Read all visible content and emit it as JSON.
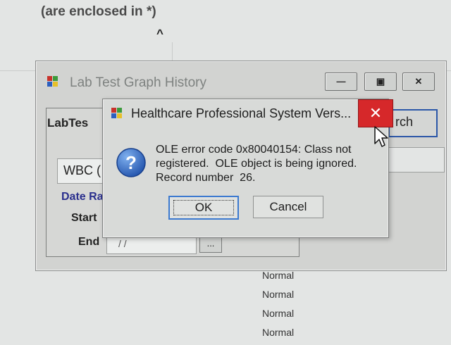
{
  "background": {
    "header_text": "(are enclosed in *)",
    "caret": "^",
    "rows": [
      "Normal",
      "Normal",
      "Normal",
      "Normal"
    ]
  },
  "back_window": {
    "title": "Lab Test Graph History",
    "minimize_glyph": "—",
    "maximize_glyph": "▣",
    "close_glyph": "✕",
    "labtest_label": "LabTes",
    "search_label": "rch",
    "wbc_value": "WBC (",
    "date_range_label": "Date Ra",
    "start_label": "Start",
    "end_label": "End",
    "end_value": "/ /",
    "browse_label": "..."
  },
  "dialog": {
    "title": "Healthcare Professional System Vers...",
    "close_glyph": "✕",
    "message_lines": [
      "OLE error code 0x80040154: Class not",
      "registered.  OLE object is being ignored.",
      "Record number  26."
    ],
    "ok_label": "OK",
    "cancel_label": "Cancel",
    "icon": "question-icon",
    "colors": {
      "close": "#d6282a",
      "question": "#2357b8",
      "focus": "#3c7ad0"
    }
  }
}
